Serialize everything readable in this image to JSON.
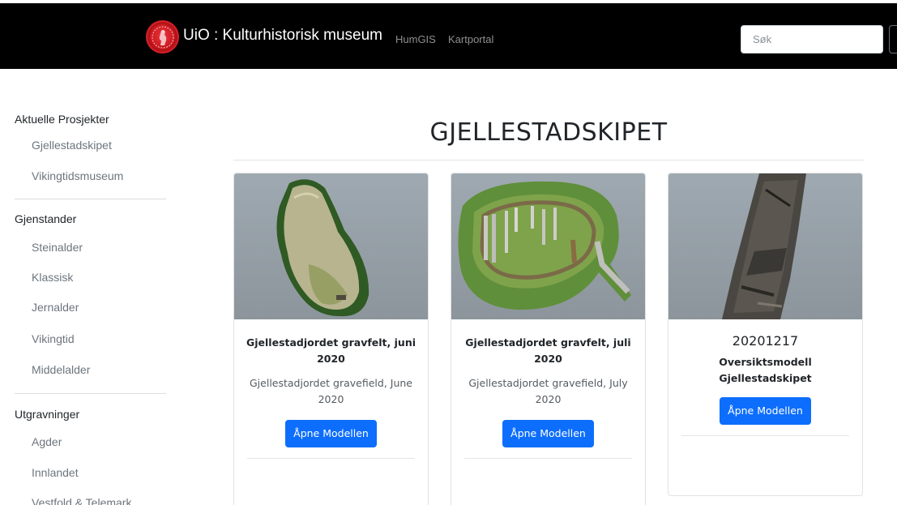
{
  "navbar": {
    "brand": "UiO : Kulturhistorisk museum",
    "links": [
      "HumGIS",
      "Kartportal"
    ],
    "search_placeholder": "Søk",
    "background": "#000000",
    "logo_color": "#d62027"
  },
  "sidebar": {
    "sections": [
      {
        "heading": "Aktuelle Prosjekter",
        "items": [
          "Gjellestadskipet",
          "Vikingtidsmuseum"
        ]
      },
      {
        "heading": "Gjenstander",
        "items": [
          "Steinalder",
          "Klassisk",
          "Jernalder",
          "Vikingtid",
          "Middelalder"
        ]
      },
      {
        "heading": "Utgravninger",
        "items": [
          "Agder",
          "Innlandet",
          "Vestfold & Telemark"
        ]
      }
    ]
  },
  "main": {
    "title": "GJELLESTADSKIPET",
    "cards": [
      {
        "title": "Gjellestadjordet gravfelt, juni 2020",
        "subtitle": "Gjellestadjordet gravefield, June 2020",
        "button": "Åpne Modellen"
      },
      {
        "title": "Gjellestadjordet gravfelt, juli 2020",
        "subtitle": "Gjellestadjordet gravefield, July 2020",
        "button": "Åpne Modellen"
      },
      {
        "date": "20201217",
        "title": "Oversiktsmodell Gjellestadskipet",
        "button": "Åpne Modellen"
      }
    ],
    "button_color": "#0d6efd"
  }
}
